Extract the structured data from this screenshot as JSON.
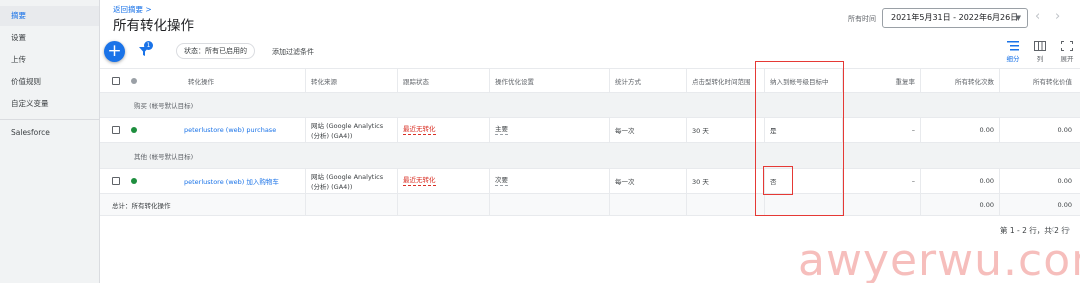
{
  "sidebar": {
    "items": [
      {
        "label": "摘要",
        "active": true
      },
      {
        "label": "设置"
      },
      {
        "label": "上传"
      },
      {
        "label": "价值规则"
      },
      {
        "label": "自定义变量"
      },
      {
        "label": "Salesforce"
      }
    ]
  },
  "header": {
    "back_link": "返回摘要 >",
    "title": "所有转化操作",
    "date_range_label": "所有时间",
    "date_range_value": "2021年5月31日 - 2022年6月26日",
    "prev_icon": "chevron-left-icon",
    "next_icon": "chevron-right-icon"
  },
  "toolbar": {
    "add_icon": "plus-icon",
    "filter_icon": "filter-icon",
    "filter_count": "1",
    "filter_chip": "状态：所有已启用的",
    "add_filter": "添加过滤条件",
    "segment_label": "细分",
    "columns_label": "列",
    "expand_label": "展开"
  },
  "table": {
    "headers": [
      "转化操作",
      "转化来源",
      "跟踪状态",
      "操作优化设置",
      "统计方式",
      "点击型转化时间范围",
      "纳入到帐号级目标中",
      "重复率",
      "所有转化次数",
      "所有转化价值"
    ],
    "groups": [
      {
        "label": "购买 (帐号默认目标)",
        "rows": [
          {
            "name": "peterlustore (web) purchase",
            "source": "网站 (Google Analytics (分析) (GA4))",
            "status": "最近无转化",
            "optimization": "主要",
            "count": "每一次",
            "window": "30 天",
            "included": "是",
            "repeat": "–",
            "conversions": "0.00",
            "value": "0.00",
            "dot_color": "#1e8e3e"
          }
        ]
      },
      {
        "label": "其他 (帐号默认目标)",
        "rows": [
          {
            "name": "peterlustore (web) 加入购物车",
            "source": "网站 (Google Analytics (分析) (GA4))",
            "status": "最近无转化",
            "optimization": "次要",
            "count": "每一次",
            "window": "30 天",
            "included": "否",
            "repeat": "–",
            "conversions": "0.00",
            "value": "0.00",
            "dot_color": "#1e8e3e"
          }
        ]
      }
    ],
    "total": {
      "label": "总计：所有转化操作",
      "conversions": "0.00",
      "value": "0.00"
    }
  },
  "pagination": {
    "text": "第 1 - 2 行，共 2 行"
  },
  "watermark": "awyerwu.com",
  "colors": {
    "accent": "#1a73e8",
    "highlight": "#e53935",
    "status_error": "#d93025",
    "active_dot": "#1e8e3e"
  }
}
